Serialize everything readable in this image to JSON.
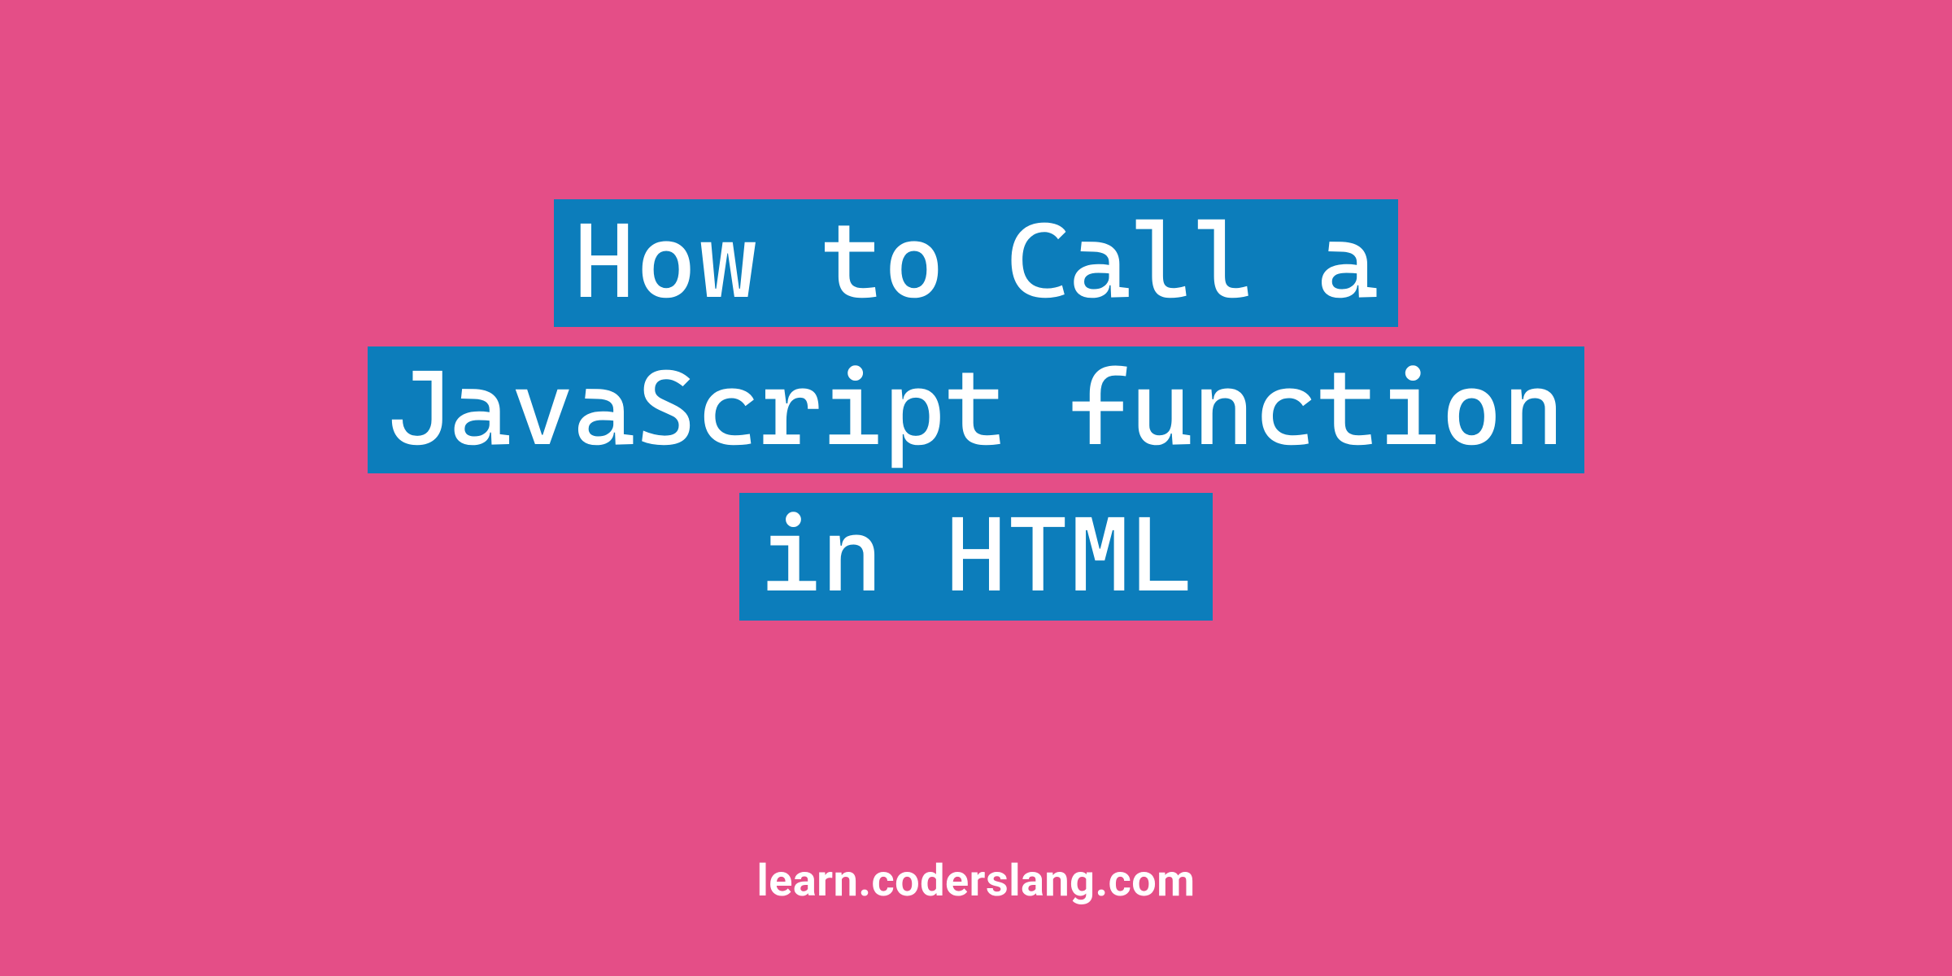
{
  "title": {
    "line1": "How to Call a",
    "line2": "JavaScript function",
    "line3": "in HTML"
  },
  "footer": "learn.coderslang.com",
  "colors": {
    "background": "#e44e87",
    "highlight": "#0c7dbb",
    "text": "#ffffff"
  }
}
